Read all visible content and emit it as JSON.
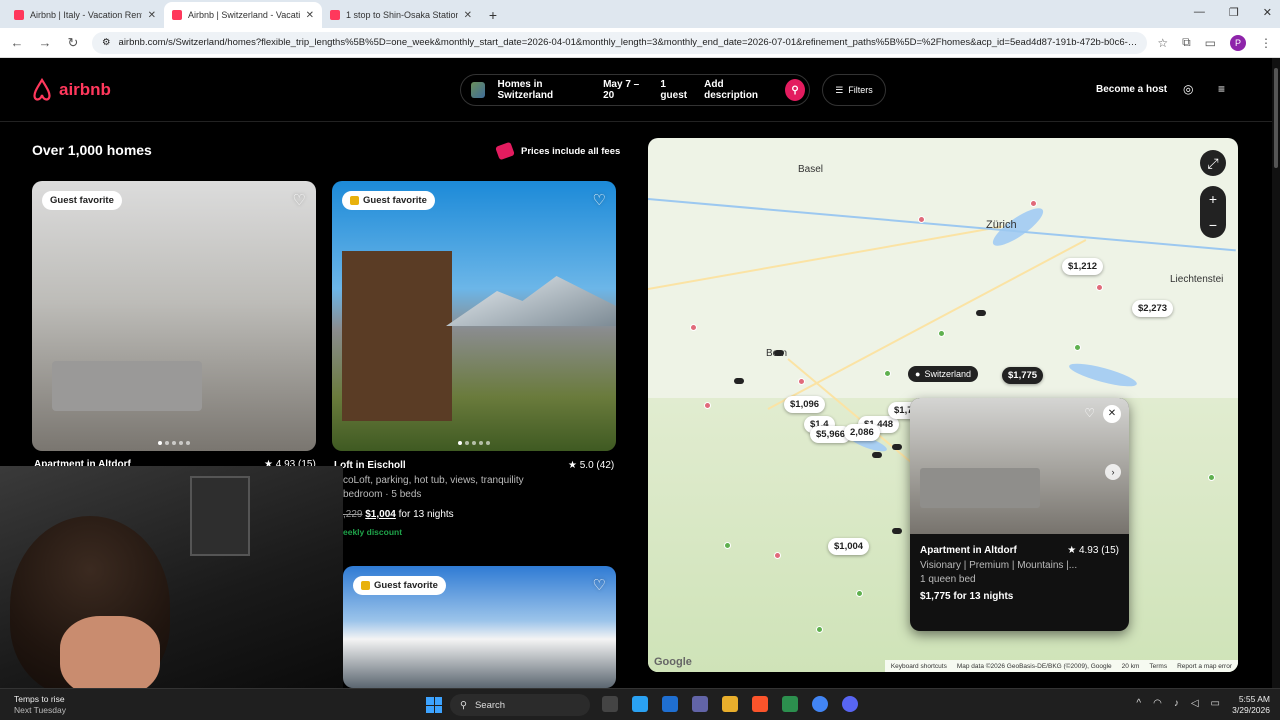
{
  "browser": {
    "tabs": [
      {
        "title": "Airbnb | Italy - Vacation Rentals"
      },
      {
        "title": "Airbnb | Switzerland - Vacation"
      },
      {
        "title": "1 stop to Shin-Osaka Station, T"
      }
    ],
    "address": "airbnb.com/s/Switzerland/homes?flexible_trip_lengths%5B%5D=one_week&monthly_start_date=2026-04-01&monthly_length=3&monthly_end_date=2026-07-01&refinement_paths%5B%5D=%2Fhomes&acp_id=5ead4d87-191b-472b-b0c6-bc5...",
    "profile_initial": "P"
  },
  "header": {
    "logo": "airbnb",
    "location": "Homes in Switzerland",
    "dates": "May 7 – 20",
    "guests": "1 guest",
    "description": "Add description",
    "filters": "Filters",
    "host": "Become a host"
  },
  "results": {
    "count": "Over 1,000 homes",
    "prices_note": "Prices include all fees"
  },
  "listings": [
    {
      "badge": "Guest favorite",
      "title": "Apartment in Altdorf",
      "rating": "★ 4.93 (15)"
    },
    {
      "badge": "Guest favorite",
      "title": "Loft in Eischoll",
      "rating": "★ 5.0 (42)",
      "desc": "coLoft, parking, hot tub, views, tranquility",
      "beds": "bedroom · 5 beds",
      "old_price": ",229",
      "price": "$1,004",
      "price_suffix": "for 13 nights",
      "discount": "eekly discount"
    },
    {
      "badge": "Guest favorite"
    }
  ],
  "map": {
    "labels": {
      "zurich": "Zürich",
      "basel": "Basel",
      "bern": "Bern",
      "liechtenstein": "Liechtenstei"
    },
    "country_pin": "Switzerland",
    "prices": {
      "p1212": "$1,212",
      "p2273": "$2,273",
      "p1775": "$1,775",
      "p1096": "$1,096",
      "p1400": "$1,4",
      "p1448": "$1,448",
      "p5966": "$5,966",
      "p2086": "2,086",
      "p1700": "$1,7",
      "p1004": "$1,004"
    },
    "google": "Google",
    "footer": {
      "shortcuts": "Keyboard shortcuts",
      "data": "Map data ©2026 GeoBasis-DE/BKG (©2009), Google",
      "scale": "20 km",
      "terms": "Terms",
      "report": "Report a map error"
    }
  },
  "popup": {
    "title": "Apartment in Altdorf",
    "rating": "★ 4.93 (15)",
    "desc": "Visionary | Premium | Mountains |...",
    "bed": "1 queen bed",
    "price": "$1,775 for 13 nights"
  },
  "taskbar": {
    "weather_title": "Temps to rise",
    "weather_sub": "Next Tuesday",
    "search": "Search",
    "time": "5:55 AM",
    "date": "3/29/2026"
  },
  "colors": {
    "brand": "#ff385c",
    "search_button": "#e31c5f"
  }
}
